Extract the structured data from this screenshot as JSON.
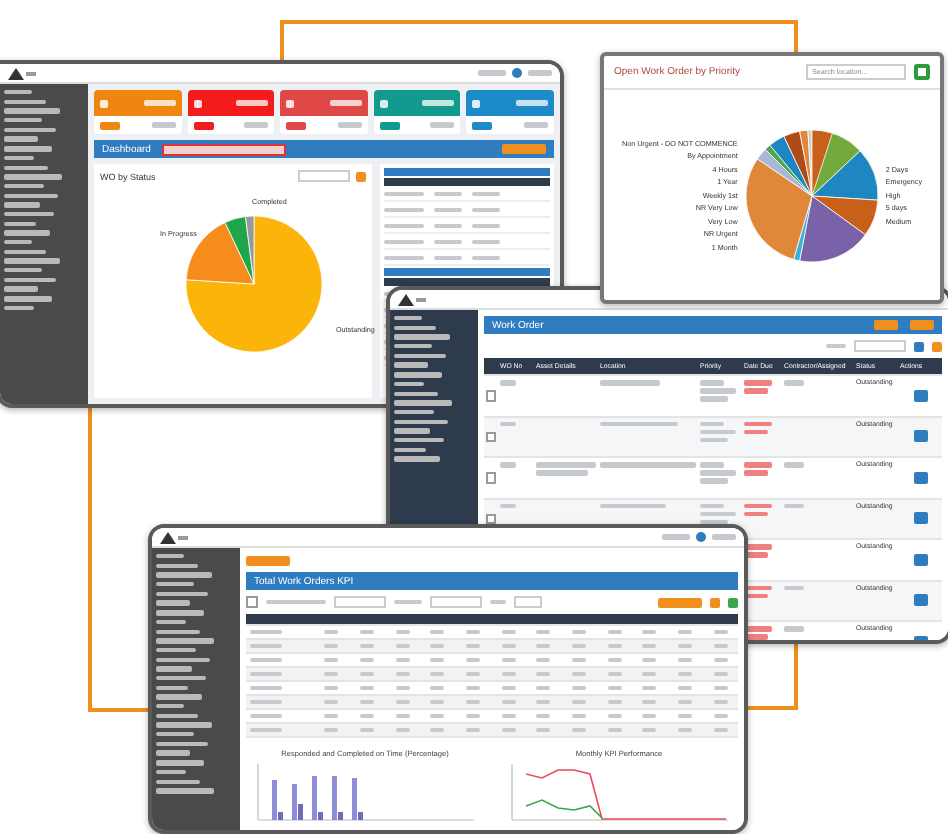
{
  "dashboard_window": {
    "section_title": "Dashboard",
    "chart_title": "WO by Status",
    "tiles": [
      {
        "color": "#f0860f"
      },
      {
        "color": "#f21c1c"
      },
      {
        "color": "#e04848"
      },
      {
        "color": "#139a8e"
      },
      {
        "color": "#1d8bc8"
      }
    ],
    "pie_labels": [
      "Completed",
      "In Progress",
      "Outstanding"
    ]
  },
  "priority_window": {
    "title": "Open Work Order by Priority",
    "search": {
      "placeholder": "Search location..."
    },
    "labels_left": [
      "Non Urgent - DO NOT COMMENCE",
      "By Appointment",
      "4 Hours",
      "1 Year",
      "Weekly 1st",
      "NR Very Low",
      "Very Low",
      "NR Urgent",
      "1 Month"
    ],
    "labels_right": [
      "2 Days",
      "Emergency",
      "High",
      "5 days",
      "Medium"
    ]
  },
  "work_order_window": {
    "title": "Work Order",
    "columns": [
      "WO No",
      "Asset Details",
      "Location",
      "Priority",
      "Date Due",
      "Contractor/Assigned",
      "Status",
      "Actions"
    ],
    "rows": [
      {
        "status": "Outstanding",
        "checked": false
      },
      {
        "status": "Outstanding",
        "checked": false
      },
      {
        "status": "Outstanding",
        "checked": false
      },
      {
        "status": "Outstanding",
        "checked": false
      },
      {
        "status": "Outstanding"
      },
      {
        "status": "Outstanding"
      },
      {
        "status": "Outstanding"
      }
    ]
  },
  "kpi_window": {
    "title": "Total Work Orders KPI",
    "filter_checked": false,
    "charts": [
      {
        "title": "Responded and Completed on Time (Percentage)",
        "kind": "bars"
      },
      {
        "title": "Monthly KPI Performance",
        "kind": "lines"
      }
    ]
  }
}
